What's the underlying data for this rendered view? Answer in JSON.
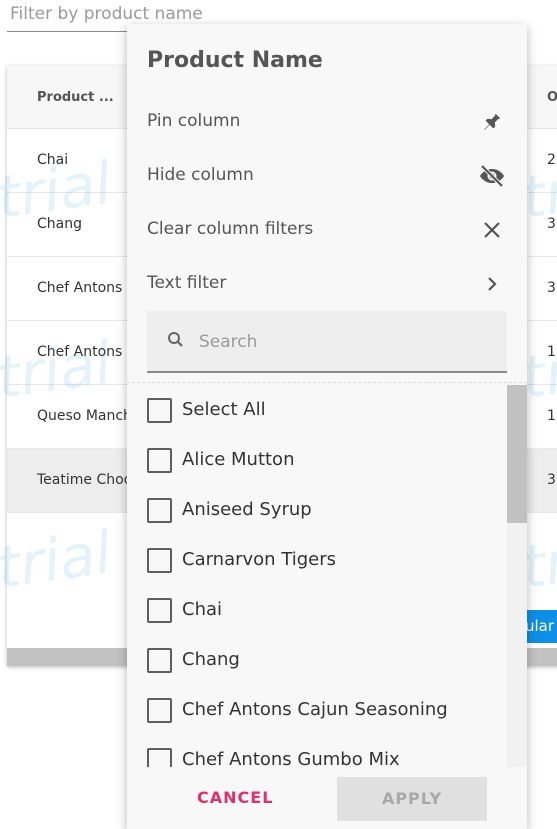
{
  "filter": {
    "placeholder": "Filter by product name"
  },
  "grid": {
    "header": {
      "col1": "Product ...",
      "col2": "O"
    },
    "rows": [
      {
        "name": "Chai",
        "value": "2"
      },
      {
        "name": "Chang",
        "value": "3"
      },
      {
        "name": "Chef Antons C",
        "value": "3"
      },
      {
        "name": "Chef Antons C",
        "value": "1"
      },
      {
        "name": "Queso Manch",
        "value": "1"
      },
      {
        "name": "Teatime Choc",
        "value": "3"
      }
    ],
    "watermark": "trial",
    "side_button": "ular"
  },
  "menu": {
    "title": "Product Name",
    "items": [
      {
        "label": "Pin column",
        "icon": "pin-icon"
      },
      {
        "label": "Hide column",
        "icon": "eye-off-icon"
      },
      {
        "label": "Clear column filters",
        "icon": "close-icon"
      },
      {
        "label": "Text filter",
        "icon": "chevron-right-icon"
      }
    ],
    "search": {
      "placeholder": "Search",
      "icon": "search-icon"
    },
    "list": [
      "Select All",
      "Alice Mutton",
      "Aniseed Syrup",
      "Carnarvon Tigers",
      "Chai",
      "Chang",
      "Chef Antons Cajun Seasoning",
      "Chef Antons Gumbo Mix"
    ],
    "cancel": "CANCEL",
    "apply": "APPLY",
    "colors": {
      "cancel": "#e0306c",
      "accent": "#0d8fe8"
    }
  }
}
